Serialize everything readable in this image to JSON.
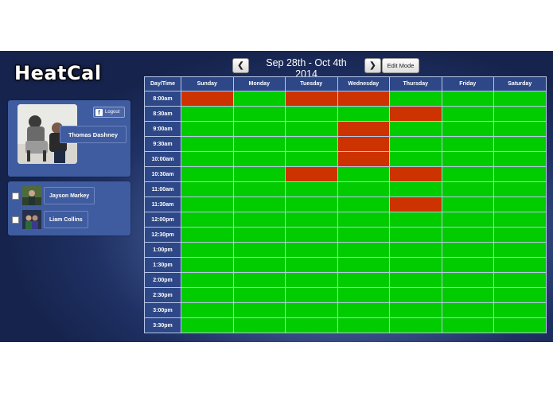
{
  "app": {
    "logo": "HeatCal"
  },
  "header": {
    "prev_icon": "chevron-left-icon",
    "next_icon": "chevron-right-icon",
    "date_range": "Sep 28th - Oct 4th 2014",
    "edit_mode_label": "Edit Mode"
  },
  "user": {
    "name": "Thomas Dashney",
    "logout_label": "Logout",
    "logout_icon": "facebook-icon"
  },
  "friends": [
    {
      "name": "Jayson Markey",
      "checked": false
    },
    {
      "name": "Liam Collins",
      "checked": false
    }
  ],
  "calendar": {
    "corner_label": "Day/Time",
    "days": [
      "Sunday",
      "Monday",
      "Tuesday",
      "Wednesday",
      "Thursday",
      "Friday",
      "Saturday"
    ],
    "times": [
      "8:00am",
      "8:30am",
      "9:00am",
      "9:30am",
      "10:00am",
      "10:30am",
      "11:00am",
      "11:30am",
      "12:00pm",
      "12:30pm",
      "1:00pm",
      "1:30pm",
      "2:00pm",
      "2:30pm",
      "3:00pm",
      "3:30pm"
    ],
    "busy": [
      [
        1,
        0,
        1,
        1,
        0,
        0,
        0
      ],
      [
        0,
        0,
        0,
        0,
        1,
        0,
        0
      ],
      [
        0,
        0,
        0,
        1,
        0,
        0,
        0
      ],
      [
        0,
        0,
        0,
        1,
        0,
        0,
        0
      ],
      [
        0,
        0,
        0,
        1,
        0,
        0,
        0
      ],
      [
        0,
        0,
        1,
        0,
        1,
        0,
        0
      ],
      [
        0,
        0,
        0,
        0,
        0,
        0,
        0
      ],
      [
        0,
        0,
        0,
        0,
        1,
        0,
        0
      ],
      [
        0,
        0,
        0,
        0,
        0,
        0,
        0
      ],
      [
        0,
        0,
        0,
        0,
        0,
        0,
        0
      ],
      [
        0,
        0,
        0,
        0,
        0,
        0,
        0
      ],
      [
        0,
        0,
        0,
        0,
        0,
        0,
        0
      ],
      [
        0,
        0,
        0,
        0,
        0,
        0,
        0
      ],
      [
        0,
        0,
        0,
        0,
        0,
        0,
        0
      ],
      [
        0,
        0,
        0,
        0,
        0,
        0,
        0
      ],
      [
        0,
        0,
        0,
        0,
        0,
        0,
        0
      ]
    ],
    "colors": {
      "free": "#00cc00",
      "busy": "#cc3300",
      "header": "#2d4787"
    }
  }
}
